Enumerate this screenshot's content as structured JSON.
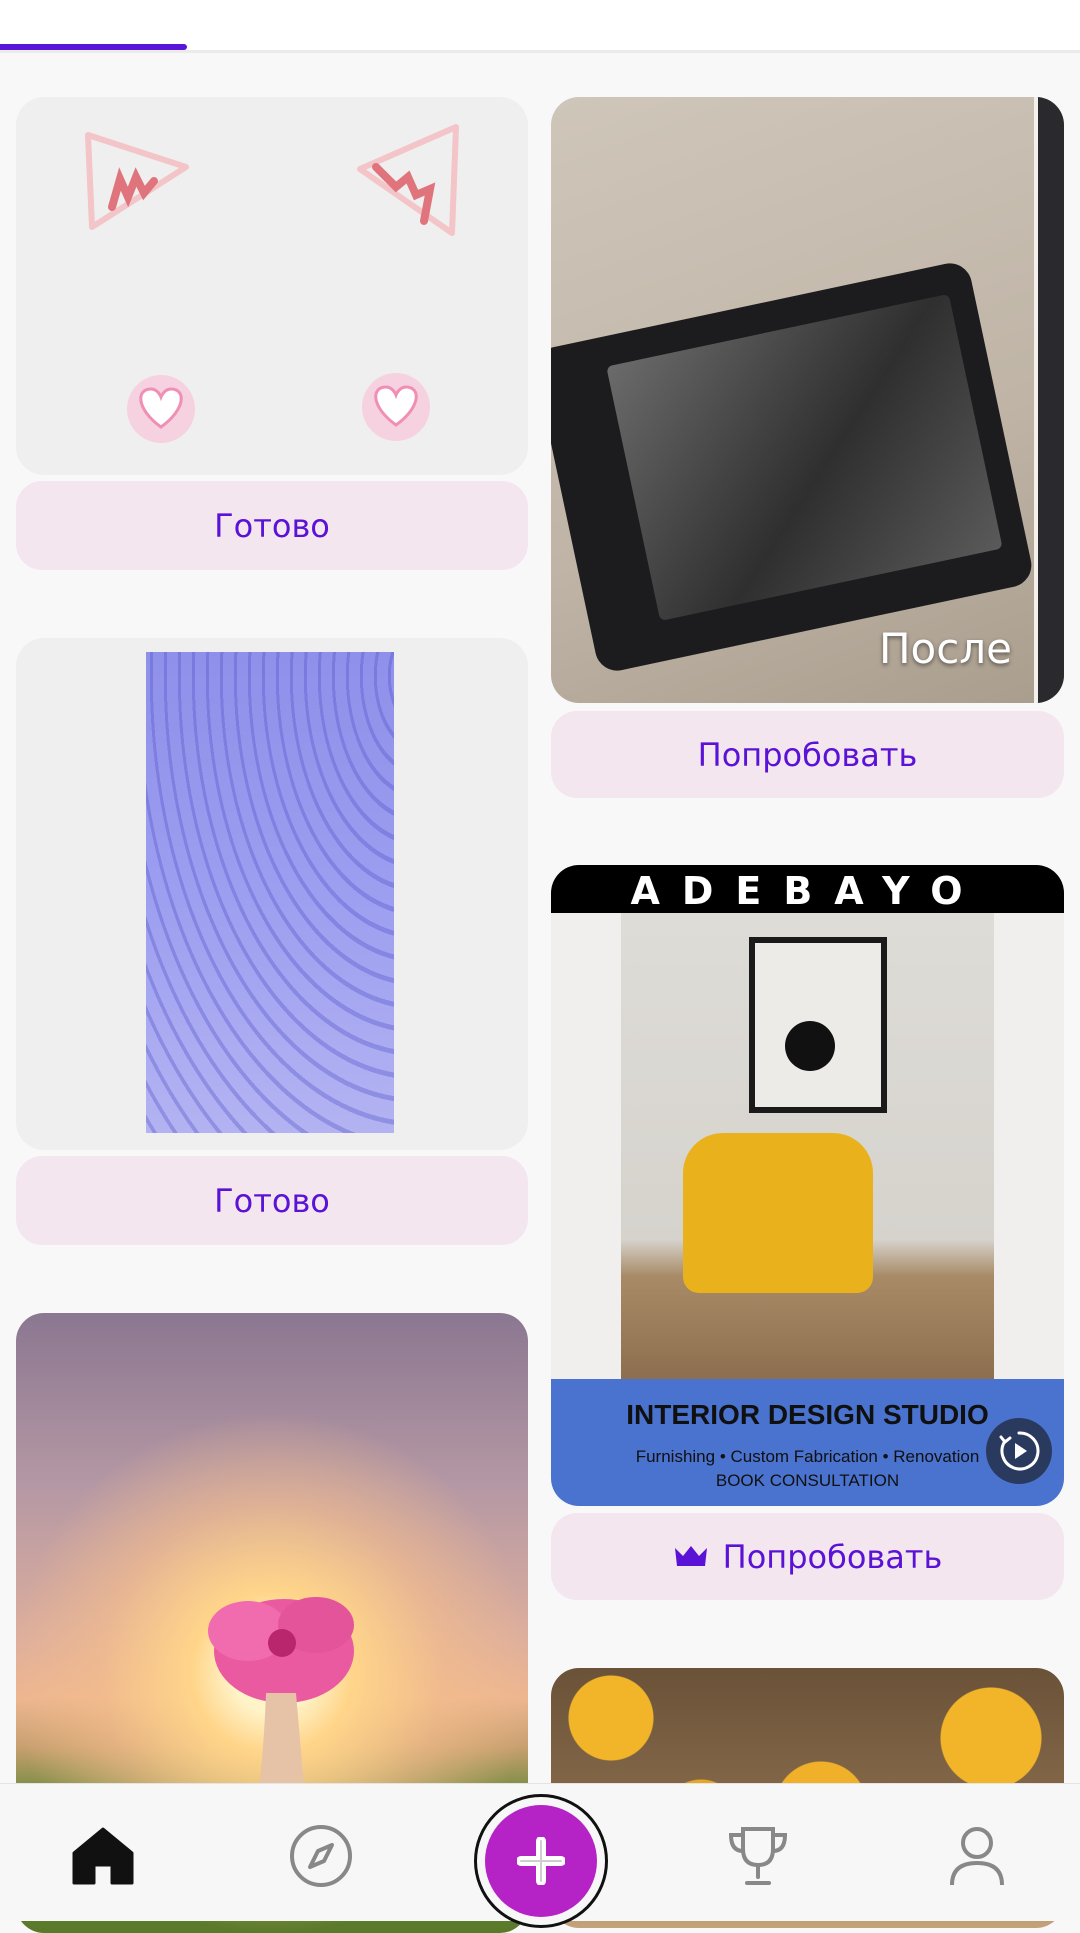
{
  "tabs": {
    "active_index": 0
  },
  "feed": {
    "left_column": [
      {
        "kind": "cat-ears-sticker",
        "button_label": "Готово"
      },
      {
        "kind": "blue-pattern",
        "button_label": "Готово"
      },
      {
        "kind": "sunset-flower-photo"
      }
    ],
    "right_column": [
      {
        "kind": "photo-frame",
        "overlay_label": "После",
        "button_label": "Попробовать"
      },
      {
        "kind": "interior-design-template",
        "brand": "ADEBAYO",
        "heading": "INTERIOR DESIGN STUDIO",
        "services": "Furnishing • Custom Fabrication • Renovation",
        "cta": "BOOK CONSULTATION",
        "button_label": "Попробовать",
        "button_icon": "crown-icon",
        "premium": true
      },
      {
        "kind": "smiley-photo"
      }
    ]
  },
  "bottom_nav": {
    "items": [
      {
        "name": "home",
        "icon": "home-icon",
        "active": true
      },
      {
        "name": "explore",
        "icon": "compass-icon"
      },
      {
        "name": "create",
        "icon": "plus-icon"
      },
      {
        "name": "challenges",
        "icon": "trophy-icon"
      },
      {
        "name": "profile",
        "icon": "user-icon"
      }
    ]
  },
  "colors": {
    "accent": "#5a12d6",
    "fab": "#b522c6",
    "button_bg": "#f3e6ef",
    "card_bg": "#efefef",
    "page_bg": "#f9f8f9"
  }
}
